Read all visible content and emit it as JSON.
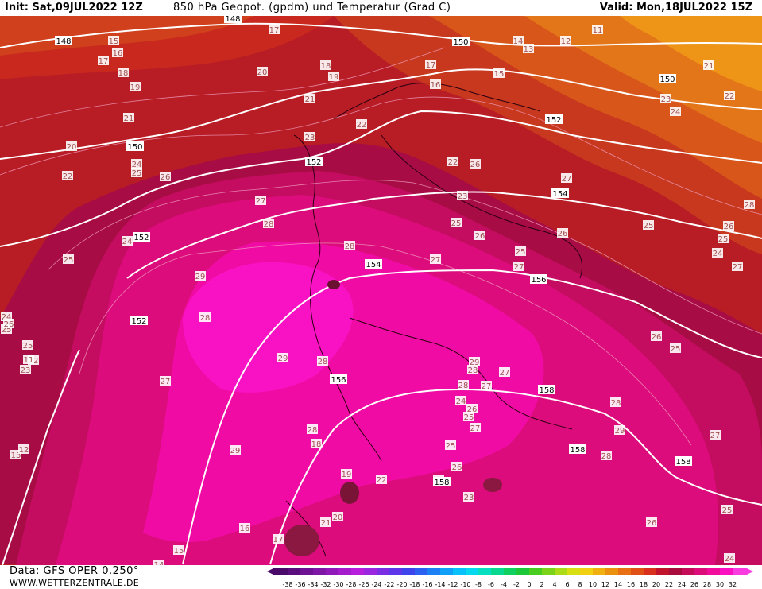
{
  "header": {
    "init": "Init: Sat,09JUL2022 12Z",
    "title": "850 hPa Geopot. (gpdm) und Temperatur (Grad C)",
    "valid": "Valid: Mon,18JUL2022 15Z"
  },
  "footer": {
    "data_source": "Data: GFS OPER 0.250°",
    "website": "WWW.WETTERZENTRALE.DE"
  },
  "legend": {
    "ticks": [
      "-38",
      "-36",
      "-34",
      "-32",
      "-30",
      "-28",
      "-26",
      "-24",
      "-22",
      "-20",
      "-18",
      "-16",
      "-14",
      "-12",
      "-10",
      "-8",
      "-6",
      "-4",
      "-2",
      "0",
      "2",
      "4",
      "6",
      "8",
      "10",
      "12",
      "14",
      "16",
      "18",
      "20",
      "22",
      "24",
      "26",
      "28",
      "30",
      "32"
    ],
    "colors": [
      "#4a0a6a",
      "#5a0e7e",
      "#6c1292",
      "#7e16a6",
      "#9019ba",
      "#a41ccc",
      "#b81fdc",
      "#9a26e0",
      "#7a2ee4",
      "#5c36e8",
      "#3e44ec",
      "#2c60f0",
      "#1c80f4",
      "#10a0f8",
      "#08c0fa",
      "#06d8f0",
      "#06e0c0",
      "#08d890",
      "#10d060",
      "#1cc838",
      "#48cc20",
      "#7cd41a",
      "#acdc18",
      "#d8e014",
      "#f0d010",
      "#f0b010",
      "#ec9010",
      "#e87012",
      "#e05016",
      "#d8301c",
      "#c0142a",
      "#a80c3c",
      "#c40c58",
      "#dc0c78",
      "#f20c9c",
      "#fa10c0",
      "#f83ce0"
    ]
  },
  "map": {
    "temperature_labels": [
      "17",
      "15",
      "16",
      "17",
      "18",
      "19",
      "21",
      "20",
      "22",
      "24",
      "25",
      "26",
      "22",
      "23",
      "24",
      "25",
      "26",
      "27",
      "28",
      "29",
      "28",
      "29",
      "28",
      "27",
      "25",
      "24",
      "23",
      "22",
      "28",
      "27",
      "26",
      "25",
      "27",
      "28",
      "29",
      "28",
      "27",
      "26",
      "25",
      "24",
      "23",
      "22",
      "21",
      "20",
      "19",
      "18",
      "17",
      "16",
      "15",
      "14",
      "13",
      "12",
      "11",
      "21",
      "22",
      "23",
      "24",
      "25",
      "26",
      "27",
      "25",
      "26",
      "27",
      "28",
      "26",
      "25",
      "24",
      "27",
      "26",
      "25",
      "28",
      "29",
      "28",
      "27",
      "26",
      "25",
      "24",
      "23",
      "22",
      "21",
      "20",
      "19",
      "18",
      "17",
      "16",
      "15",
      "14",
      "13",
      "12",
      "11",
      "25",
      "24",
      "25",
      "26",
      "27",
      "28",
      "29"
    ],
    "geopotential_labels": [
      "148",
      "148",
      "150",
      "150",
      "150",
      "152",
      "152",
      "152",
      "152",
      "154",
      "154",
      "156",
      "156",
      "158",
      "158",
      "158",
      "158"
    ],
    "colors": {
      "temp_11": "#e88a14",
      "temp_16": "#d8501a",
      "temp_20": "#b81c24",
      "temp_24": "#b00c4c",
      "temp_26": "#d40c6c",
      "temp_28": "#ec0c98",
      "temp_30": "#f810c0"
    }
  }
}
